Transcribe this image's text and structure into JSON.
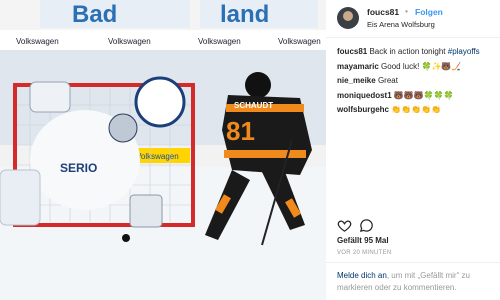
{
  "post": {
    "username": "foucs81",
    "separator": "•",
    "follow_label": "Folgen",
    "location": "Eis Arena Wolfsburg"
  },
  "photo": {
    "boards": [
      "Bad",
      "land",
      "Volkswagen",
      "Volkswagen",
      "Volkswagen",
      "Volkswagen",
      "Volkswagen"
    ],
    "jersey_number": "81",
    "jersey_name": "SCHAUDT",
    "goalie_logo": "SERIO"
  },
  "comments": [
    {
      "user": "foucs81",
      "text": "Back in action tonight ",
      "tag": "#playoffs"
    },
    {
      "user": "mayamaric",
      "text": "Good luck! 🍀✨🐻🏒",
      "tag": ""
    },
    {
      "user": "nie_meike",
      "text": "Great",
      "tag": ""
    },
    {
      "user": "moniquedost1",
      "text": "🐻🐻🐻🍀🍀🍀",
      "tag": ""
    },
    {
      "user": "wolfsburgehc",
      "text": "👏👏👏👏👏",
      "tag": ""
    }
  ],
  "likes_text": "Gefällt 95 Mal",
  "time_text": "VOR 20 MINUTEN",
  "login": {
    "link": "Melde dich an",
    "rest": ", um mit „Gefällt mir“ zu markieren oder zu kommentieren."
  },
  "icons": [
    "heart-icon",
    "comment-icon"
  ],
  "colors": {
    "link": "#3897f0",
    "tag": "#003569",
    "muted": "#999999",
    "jersey_orange": "#f08a1c",
    "ice": "#eef1f4"
  }
}
